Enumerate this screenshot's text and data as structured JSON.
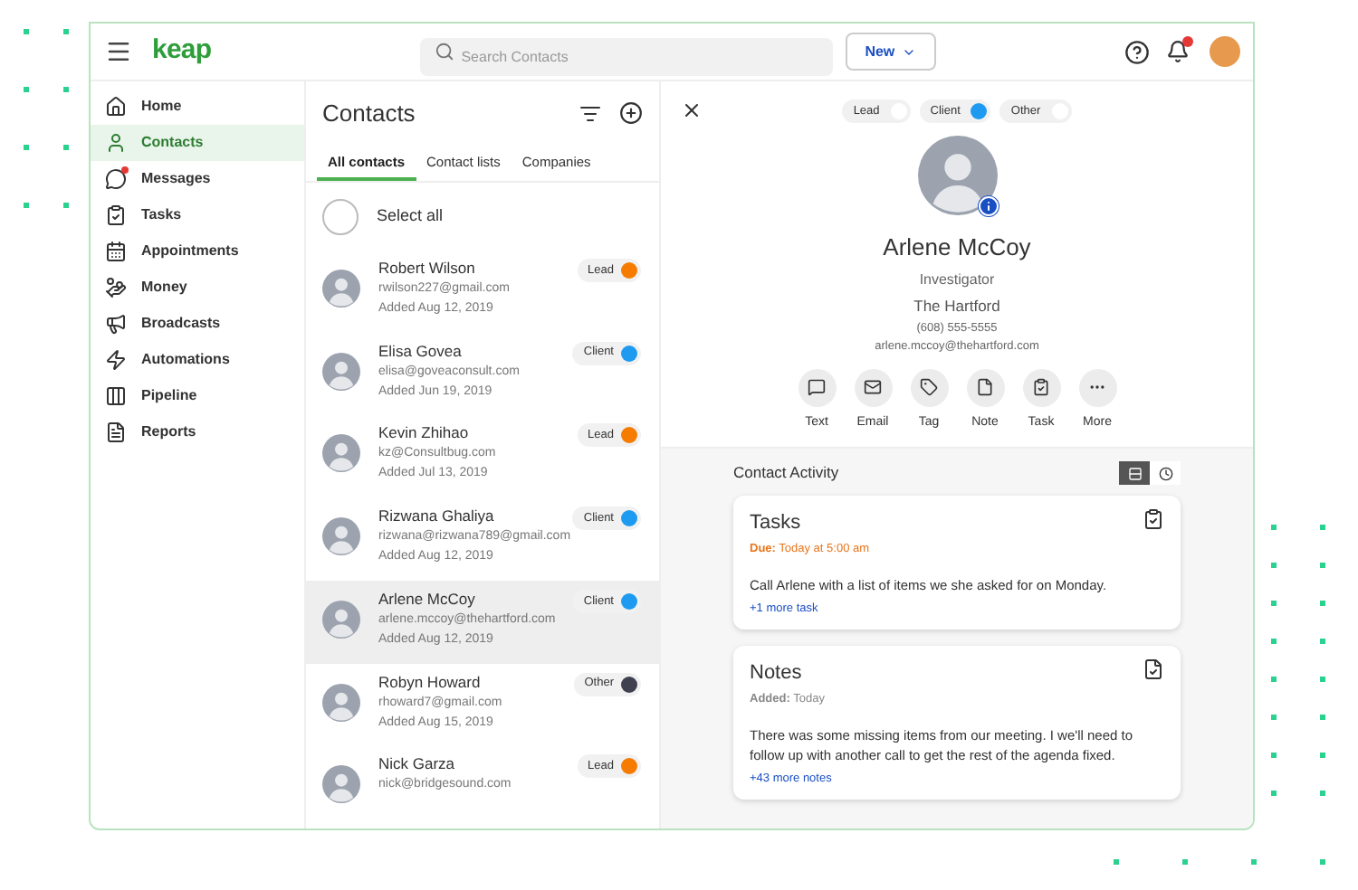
{
  "app": {
    "logo": "keap"
  },
  "search": {
    "placeholder": "Search Contacts"
  },
  "new_button": {
    "label": "New"
  },
  "notifications": {
    "unread": true
  },
  "sidebar": {
    "items": [
      {
        "kind": "home",
        "label": "Home",
        "selected": false,
        "badge": false
      },
      {
        "kind": "contacts",
        "label": "Contacts",
        "selected": true,
        "badge": false
      },
      {
        "kind": "messages",
        "label": "Messages",
        "selected": false,
        "badge": true
      },
      {
        "kind": "tasks",
        "label": "Tasks",
        "selected": false,
        "badge": false
      },
      {
        "kind": "appointments",
        "label": "Appointments",
        "selected": false,
        "badge": false
      },
      {
        "kind": "money",
        "label": "Money",
        "selected": false,
        "badge": false
      },
      {
        "kind": "broadcasts",
        "label": "Broadcasts",
        "selected": false,
        "badge": false
      },
      {
        "kind": "automations",
        "label": "Automations",
        "selected": false,
        "badge": false
      },
      {
        "kind": "pipeline",
        "label": "Pipeline",
        "selected": false,
        "badge": false
      },
      {
        "kind": "reports",
        "label": "Reports",
        "selected": false,
        "badge": false
      }
    ]
  },
  "contacts": {
    "title": "Contacts",
    "tabs": [
      {
        "label": "All contacts",
        "selected": true
      },
      {
        "label": "Contact lists",
        "selected": false
      },
      {
        "label": "Companies",
        "selected": false
      }
    ],
    "select_all": {
      "label": "Select all",
      "checked": false
    },
    "rows": [
      {
        "name": "Robert Wilson",
        "email": "rwilson227@gmail.com",
        "added": "Added Aug 12, 2019",
        "tag": "Lead",
        "color": "#f57c00",
        "selected": false
      },
      {
        "name": "Elisa Govea",
        "email": "elisa@goveaconsult.com",
        "added": "Added Jun 19, 2019",
        "tag": "Client",
        "color": "#1e9bf0",
        "selected": false
      },
      {
        "name": "Kevin Zhihao",
        "email": "kz@Consultbug.com",
        "added": "Added Jul 13, 2019",
        "tag": "Lead",
        "color": "#f57c00",
        "selected": false
      },
      {
        "name": "Rizwana Ghaliya",
        "email": "rizwana@rizwana789@gmail.com",
        "added": "Added Aug 12, 2019",
        "tag": "Client",
        "color": "#1e9bf0",
        "selected": false
      },
      {
        "name": "Arlene McCoy",
        "email": "arlene.mccoy@thehartford.com",
        "added": "Added Aug 12, 2019",
        "tag": "Client",
        "color": "#1e9bf0",
        "selected": true
      },
      {
        "name": "Robyn Howard",
        "email": "rhoward7@gmail.com",
        "added": "Added Aug 15, 2019",
        "tag": "Other",
        "color": "#3f4150",
        "selected": false
      },
      {
        "name": "Nick Garza",
        "email": "nick@bridgesound.com",
        "tag": "Lead",
        "color": "#f57c00",
        "selected": false
      }
    ]
  },
  "detail": {
    "status_toggles": [
      {
        "label": "Lead",
        "selected": false
      },
      {
        "label": "Client",
        "selected": true
      },
      {
        "label": "Other",
        "selected": false
      }
    ],
    "name": "Arlene McCoy",
    "job_title": "Investigator",
    "company": "The Hartford",
    "phone": "(608) 555-5555",
    "email": "arlene.mccoy@thehartford.com",
    "actions": [
      {
        "kind": "text",
        "label": "Text"
      },
      {
        "kind": "email",
        "label": "Email"
      },
      {
        "kind": "tag",
        "label": "Tag"
      },
      {
        "kind": "note",
        "label": "Note"
      },
      {
        "kind": "task",
        "label": "Task"
      },
      {
        "kind": "more",
        "label": "More"
      }
    ],
    "activity": {
      "title": "Contact Activity",
      "views": [
        {
          "kind": "list",
          "selected": true
        },
        {
          "kind": "history",
          "selected": false
        }
      ],
      "cards": [
        {
          "kind": "task",
          "title": "Tasks",
          "meta_label": "Due:",
          "meta_value": "Today at 5:00 am",
          "overdue": true,
          "body": "Call Arlene with a list of items we she asked for on Monday.",
          "more": "+1 more task"
        },
        {
          "kind": "note",
          "title": "Notes",
          "meta_label": "Added:",
          "meta_value": "Today",
          "overdue": false,
          "body": "There was some missing items from our meeting. I we'll need to follow up with another call to get the rest of the agenda fixed.",
          "more": "+43 more notes"
        }
      ]
    }
  }
}
